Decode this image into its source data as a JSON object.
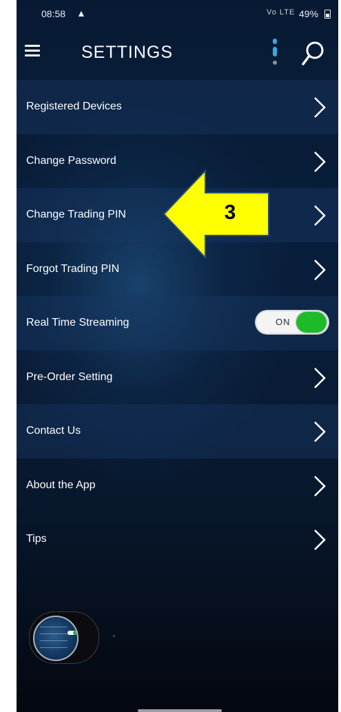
{
  "status_bar": {
    "time": "08:58",
    "alert_icon": "warning-icon",
    "signal_text": "Vo LTE",
    "battery": "49%"
  },
  "header": {
    "title": "SETTINGS",
    "menu_icon": "hamburger-menu-icon",
    "more_icon": "vertical-dots-icon",
    "search_icon": "search-icon"
  },
  "settings": {
    "items": [
      {
        "label": "Registered Devices",
        "control": "chevron"
      },
      {
        "label": "Change Password",
        "control": "chevron"
      },
      {
        "label": "Change Trading PIN",
        "control": "chevron"
      },
      {
        "label": "Forgot Trading PIN",
        "control": "chevron"
      },
      {
        "label": "Real Time Streaming",
        "control": "toggle"
      },
      {
        "label": "Pre-Order Setting",
        "control": "chevron"
      },
      {
        "label": "Contact Us",
        "control": "chevron"
      },
      {
        "label": "About the App",
        "control": "chevron"
      },
      {
        "label": "Tips",
        "control": "chevron"
      }
    ],
    "streaming_toggle": {
      "text": "ON",
      "state": true
    }
  },
  "annotation": {
    "number": "3",
    "color": "#ffff00"
  },
  "colors": {
    "background_top": "#081a33",
    "accent_blue": "#3aa9e0",
    "toggle_green": "#1dbb2a",
    "text": "#ffffff"
  }
}
